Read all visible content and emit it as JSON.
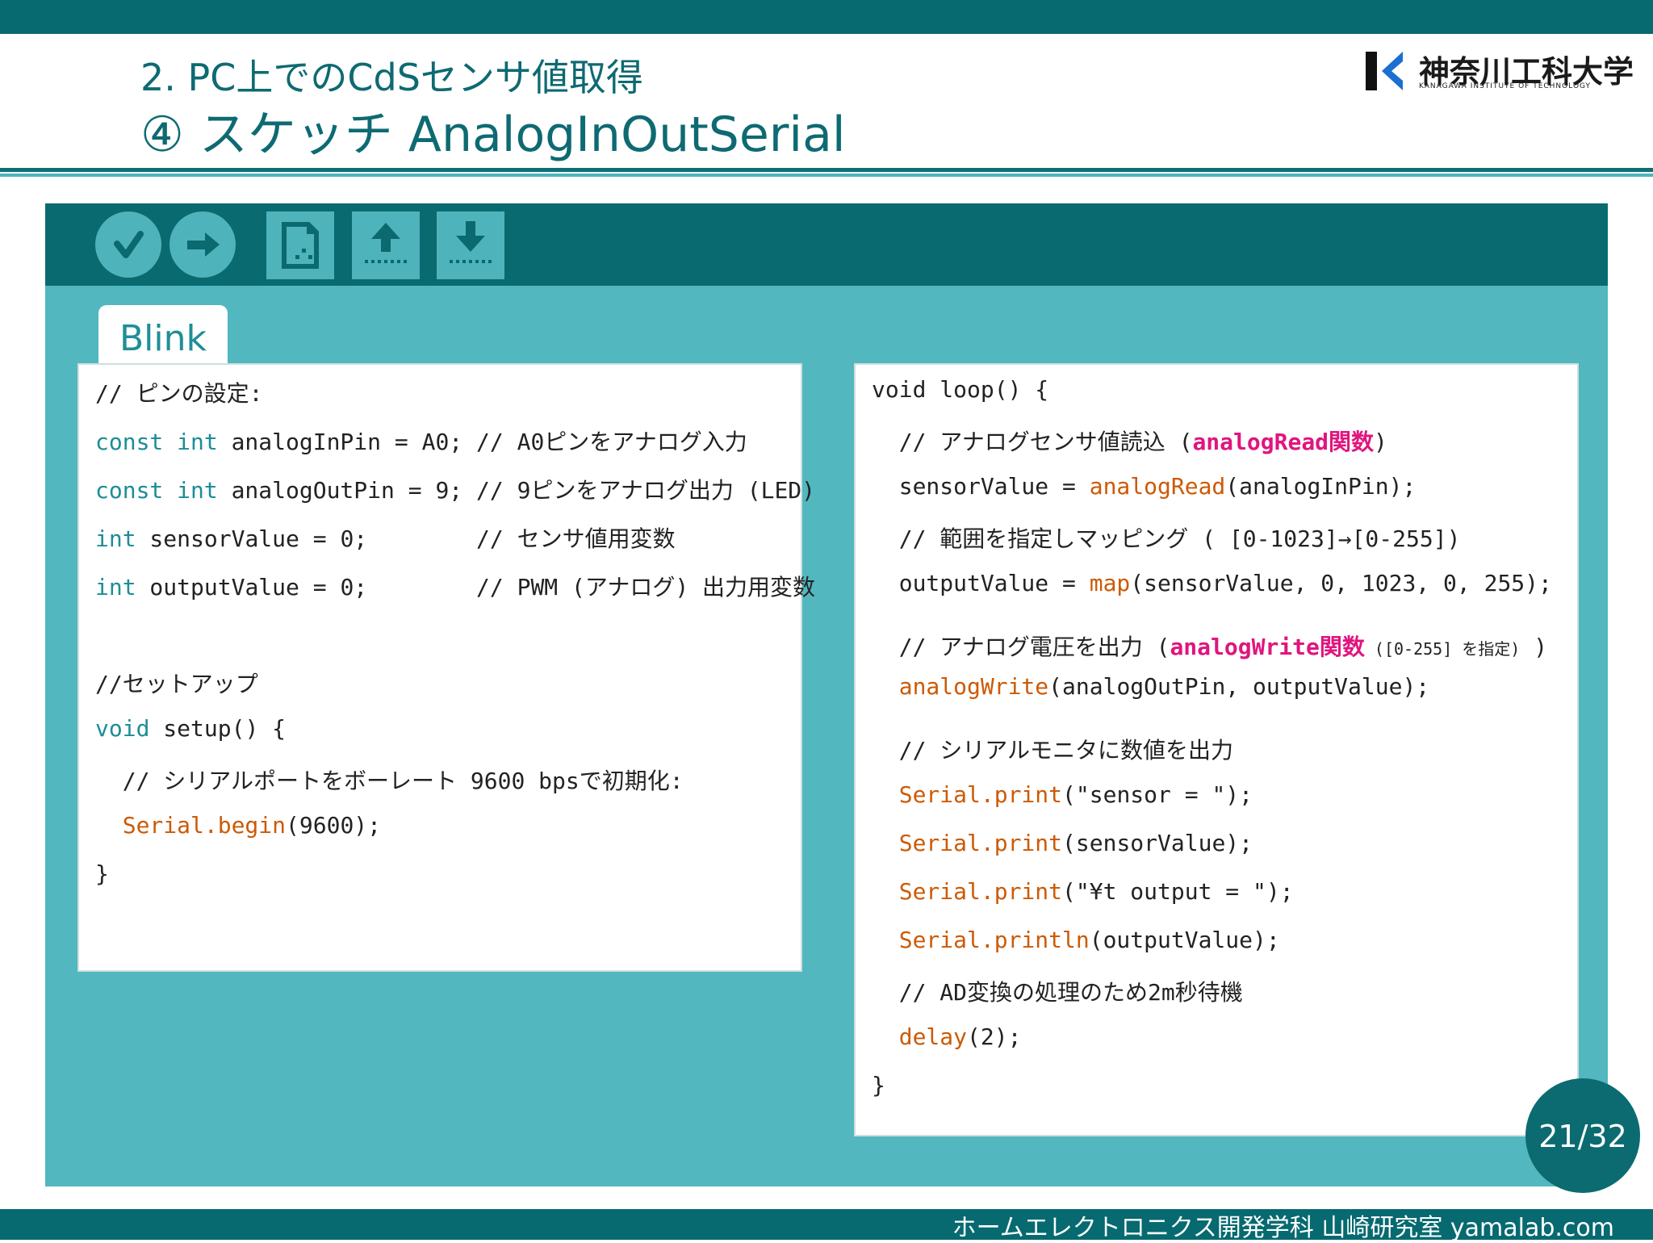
{
  "header": {
    "subtitle": "2. PC上でのCdSセンサ値取得",
    "title": "④ スケッチ AnalogInOutSerial"
  },
  "logo": {
    "name": "神奈川工科大学",
    "sub": "KANAGAWA INSTITUTE OF TECHNOLOGY"
  },
  "toolbar": {
    "buttons": [
      {
        "name": "verify",
        "icon": "check-icon"
      },
      {
        "name": "upload",
        "icon": "arrow-right-icon"
      },
      {
        "name": "new",
        "icon": "document-icon"
      },
      {
        "name": "open",
        "icon": "arrow-up-icon"
      },
      {
        "name": "save",
        "icon": "arrow-down-icon"
      }
    ]
  },
  "tab": {
    "label": "Blink"
  },
  "left_code": {
    "l1": "// ピンの設定:",
    "l2_kw": "const int",
    "l2_rest": " analogInPin = A0; // A0ピンをアナログ入力",
    "l3_kw": "const int",
    "l3_rest": " analogOutPin = 9; // 9ピンをアナログ出力 (LED)",
    "l4_kw": "int",
    "l4_rest": " sensorValue = 0;        // センサ値用変数",
    "l5_kw": "int",
    "l5_rest": " outputValue = 0;        // PWM (アナログ) 出力用変数",
    "l6": "//セットアップ",
    "l7_kw": "void",
    "l7_rest": " setup() {",
    "l8": "  // シリアルポートをボーレート 9600 bpsで初期化:",
    "l9_fn": "  Serial.begin",
    "l9_rest": "(9600);",
    "l10": "}"
  },
  "right_code": {
    "l1": "void loop() {",
    "l2_a": "  // アナログセンサ値読込 (",
    "l2_hl": "analogRead関数",
    "l2_b": ")",
    "l3_a": "  sensorValue = ",
    "l3_fn": "analogRead",
    "l3_b": "(analogInPin);",
    "l4": "  // 範囲を指定しマッピング ( [0-1023]→[0-255])",
    "l5_a": "  outputValue = ",
    "l5_fn": "map",
    "l5_b": "(sensorValue, 0, 1023, 0, 255);",
    "l6_a": "  // アナログ電圧を出力 (",
    "l6_hl": "analogWrite関数",
    "l6_small": " ([0-255] を指定)",
    "l6_b": " )",
    "l7_fn": "  analogWrite",
    "l7_b": "(analogOutPin, outputValue);",
    "l8": "  // シリアルモニタに数値を出力",
    "l9_fn": "  Serial.print",
    "l9_b": "(\"sensor = \");",
    "l10_fn": "  Serial.print",
    "l10_b": "(sensorValue);",
    "l11_fn": "  Serial.print",
    "l11_b": "(\"¥t output = \");",
    "l12_fn": "  Serial.println",
    "l12_b": "(outputValue);",
    "l13": "  // AD変換の処理のため2m秒待機",
    "l14_fn": "  delay",
    "l14_b": "(2);",
    "l15": "}"
  },
  "page": {
    "number": "21/32"
  },
  "footer": {
    "text": "ホームエレクトロニクス開発学科 山崎研究室 yamalab.com"
  },
  "colors": {
    "teal_dark": "#066a70",
    "teal_light": "#52b7bf",
    "keyword": "#1c8d97",
    "function": "#cc5a05",
    "highlight": "#e0157f"
  }
}
